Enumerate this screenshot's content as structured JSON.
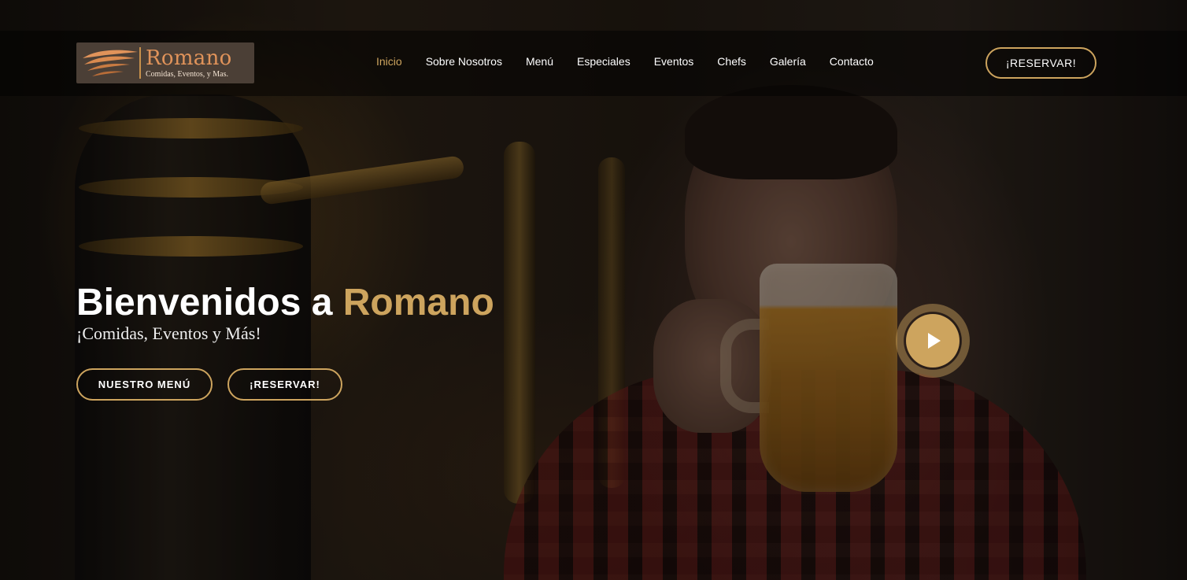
{
  "brand": {
    "name": "Romano",
    "tagline": "Comidas, Eventos, y Mas."
  },
  "nav": {
    "items": [
      {
        "label": "Inicio",
        "active": true
      },
      {
        "label": "Sobre Nosotros",
        "active": false
      },
      {
        "label": "Menú",
        "active": false
      },
      {
        "label": "Especiales",
        "active": false
      },
      {
        "label": "Eventos",
        "active": false
      },
      {
        "label": "Chefs",
        "active": false
      },
      {
        "label": "Galería",
        "active": false
      },
      {
        "label": "Contacto",
        "active": false
      }
    ],
    "reserve_label": "¡RESERVAR!"
  },
  "hero": {
    "title_prefix": "Bienvenidos a ",
    "title_brand": "Romano",
    "subtitle": "¡Comidas, Eventos y Más!",
    "menu_button": "NUESTRO MENÚ",
    "reserve_button": "¡RESERVAR!",
    "play_icon": "play-icon"
  },
  "colors": {
    "accent": "#cda45e",
    "logo_text": "#e0935a",
    "header_bg": "rgba(0,0,0,0.45)"
  }
}
